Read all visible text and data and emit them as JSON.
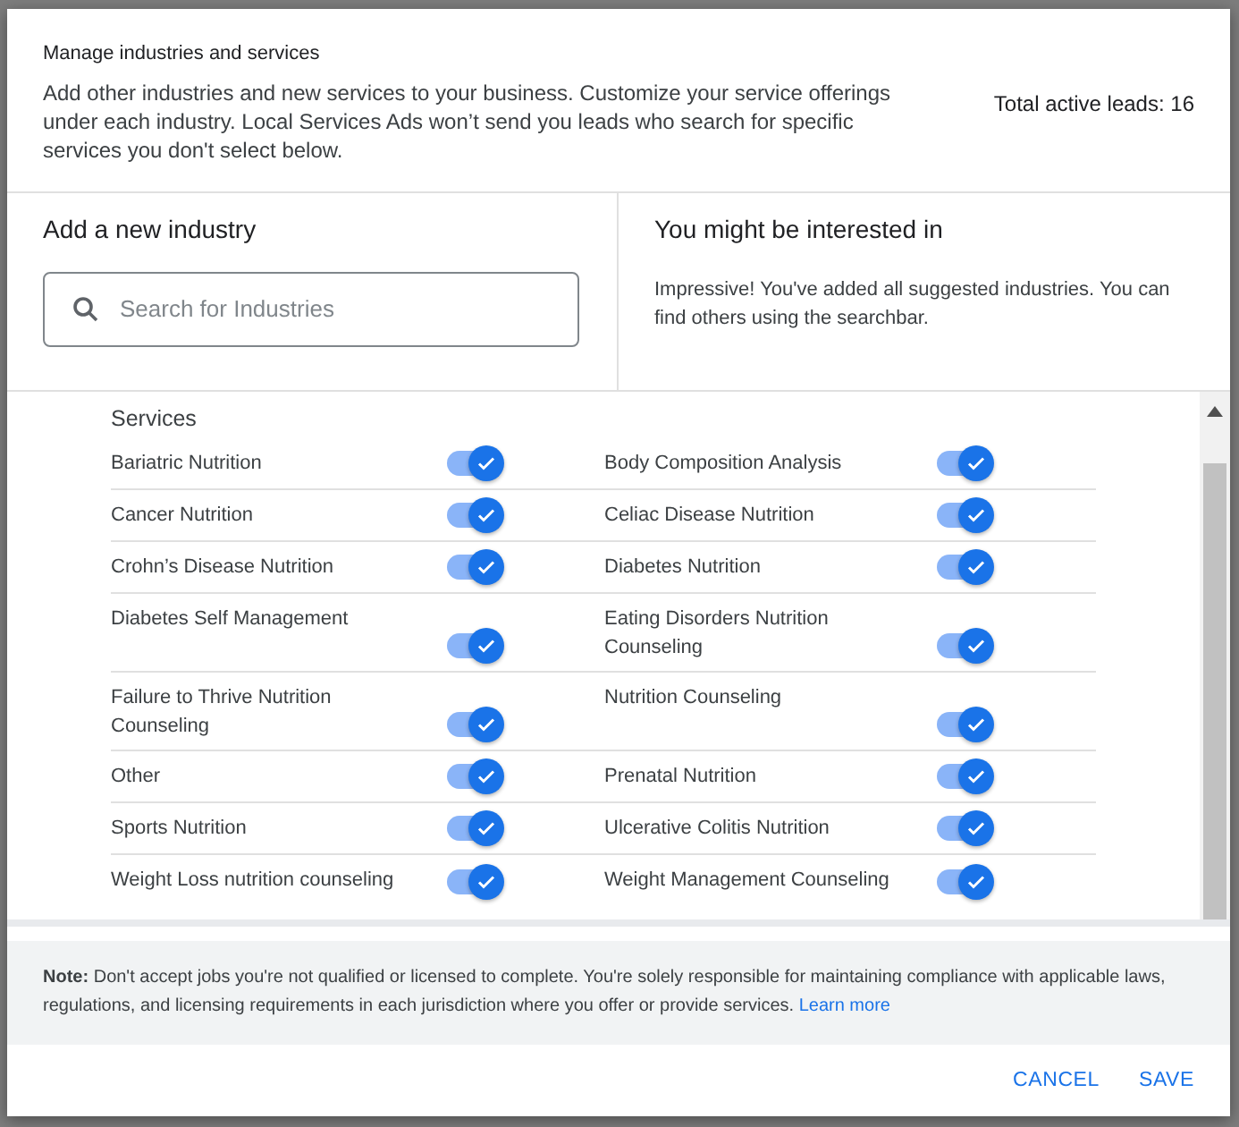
{
  "dialog": {
    "title": "Manage industries and services",
    "description": "Add other industries and new services to your business. Customize your service offerings under each industry. Local Services Ads won’t send you leads who search for specific services you don't select below.",
    "total_leads": "Total active leads: 16"
  },
  "add_industry": {
    "heading": "Add a new industry",
    "search": {
      "placeholder": "Search for Industries"
    }
  },
  "suggestions": {
    "heading": "You might be interested in",
    "message": "Impressive! You've added all suggested industries. You can find others using the searchbar."
  },
  "services": {
    "heading": "Services",
    "items": [
      {
        "label": "Bariatric Nutrition",
        "on": true
      },
      {
        "label": "Body Composition Analysis",
        "on": true
      },
      {
        "label": "Cancer Nutrition",
        "on": true
      },
      {
        "label": "Celiac Disease Nutrition",
        "on": true
      },
      {
        "label": "Crohn’s Disease Nutrition",
        "on": true
      },
      {
        "label": "Diabetes Nutrition",
        "on": true
      },
      {
        "label": "Diabetes Self Management",
        "on": true
      },
      {
        "label": "Eating Disorders Nutrition Counseling",
        "on": true
      },
      {
        "label": "Failure to Thrive Nutrition Counseling",
        "on": true
      },
      {
        "label": "Nutrition Counseling",
        "on": true
      },
      {
        "label": "Other",
        "on": true
      },
      {
        "label": "Prenatal Nutrition",
        "on": true
      },
      {
        "label": "Sports Nutrition",
        "on": true
      },
      {
        "label": "Ulcerative Colitis Nutrition",
        "on": true
      },
      {
        "label": "Weight Loss nutrition counseling",
        "on": true
      },
      {
        "label": "Weight Management Counseling",
        "on": true
      }
    ]
  },
  "note": {
    "text": "**Note:** Don't accept jobs you're not qualified or licensed to complete. You're solely responsible for maintaining compliance with applicable laws, regulations, and licensing requirements in each jurisdiction where you offer or provide services.",
    "link": "Learn more"
  },
  "buttons": [
    {
      "label": "CANCEL"
    },
    {
      "label": "SAVE"
    }
  ]
}
